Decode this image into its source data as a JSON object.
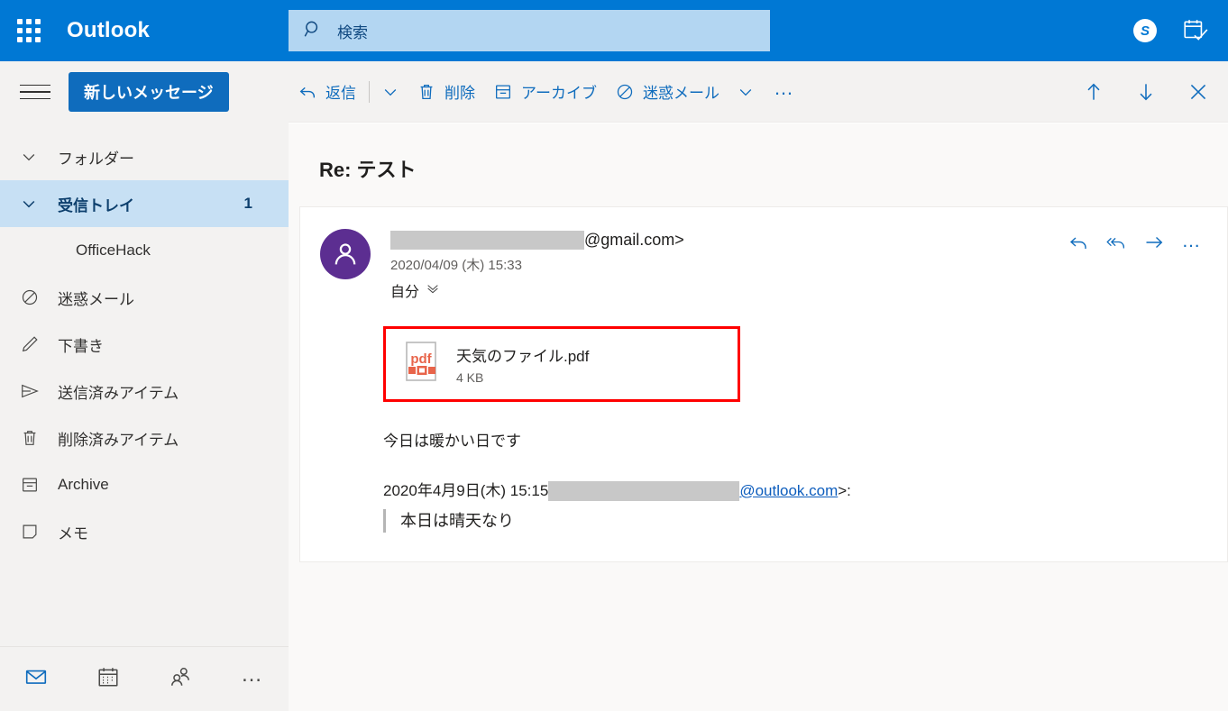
{
  "header": {
    "app_launcher_icon": "waffle-grid-icon",
    "brand": "Outlook",
    "search": {
      "icon": "search-icon",
      "placeholder": "検索",
      "value": ""
    },
    "skype_icon_letter": "S",
    "skype_icon": "skype-icon",
    "calendar_icon": "calendar-check-icon",
    "background_color": "#0078d4"
  },
  "commandbar": {
    "reply": {
      "label": "返信",
      "icon": "reply-arrow-icon"
    },
    "reply_caret": "chevron-down-icon",
    "delete": {
      "label": "削除",
      "icon": "trash-icon"
    },
    "archive": {
      "label": "アーカイブ",
      "icon": "archive-box-icon"
    },
    "junk": {
      "label": "迷惑メール",
      "icon": "block-circle-icon"
    },
    "junk_caret": "chevron-down-icon",
    "overflow": "…",
    "move_up": "up-arrow-icon",
    "move_down": "down-arrow-icon",
    "close": "close-x-icon",
    "accent_color": "#0f6cbd"
  },
  "sidebar": {
    "menu_icon": "hamburger-icon",
    "new_message_label": "新しいメッセージ",
    "new_message_color": "#0f6cbd",
    "selected_row_color": "#c7e0f4",
    "items": [
      {
        "label": "フォルダー",
        "icon": "chevron-down-icon",
        "type": "header",
        "count": "",
        "selected": false
      },
      {
        "label": "受信トレイ",
        "icon": "chevron-down-icon",
        "type": "header",
        "count": "1",
        "selected": true
      },
      {
        "label": "OfficeHack",
        "icon": "",
        "type": "child",
        "count": "",
        "selected": false
      },
      {
        "label": "迷惑メール",
        "icon": "block-circle-icon",
        "type": "folder",
        "count": "",
        "selected": false
      },
      {
        "label": "下書き",
        "icon": "pencil-icon",
        "type": "folder",
        "count": "",
        "selected": false
      },
      {
        "label": "送信済みアイテム",
        "icon": "send-icon",
        "type": "folder",
        "count": "",
        "selected": false
      },
      {
        "label": "削除済みアイテム",
        "icon": "trash-icon",
        "type": "folder",
        "count": "",
        "selected": false
      },
      {
        "label": "Archive",
        "icon": "archive-box-icon",
        "type": "folder",
        "count": "",
        "selected": false
      },
      {
        "label": "メモ",
        "icon": "note-icon",
        "type": "folder",
        "count": "",
        "selected": false
      }
    ],
    "bottom_nav": [
      {
        "name": "mail",
        "icon": "mail-icon",
        "active": true
      },
      {
        "name": "calendar",
        "icon": "calendar-icon",
        "active": false
      },
      {
        "name": "people",
        "icon": "people-icon",
        "active": false
      },
      {
        "name": "more",
        "icon": "more-dots-icon",
        "active": false
      }
    ]
  },
  "message": {
    "subject": "Re: テスト",
    "avatar_color": "#5c2e91",
    "sender_domain": "@gmail.com>",
    "sender_redacted": true,
    "datetime": "2020/04/09 (木) 15:33",
    "to_label": "自分",
    "to_caret": "double-chevron-down-icon",
    "actions": {
      "reply": "reply-arrow-icon",
      "reply_all": "reply-all-arrow-icon",
      "forward": "forward-arrow-icon",
      "more": "…"
    },
    "attachment": {
      "file_icon": "pdf-file-icon",
      "filename": "天気のファイル.pdf",
      "size": "4 KB",
      "highlight_color": "#ff0000"
    },
    "body_text": "今日は暖かい日です",
    "quote_date": "2020年4月9日(木) 15:15",
    "quote_email_domain": "@outlook.com",
    "quote_email_suffix": ">:",
    "quote_redacted": true,
    "quoted_text": "本日は晴天なり"
  }
}
